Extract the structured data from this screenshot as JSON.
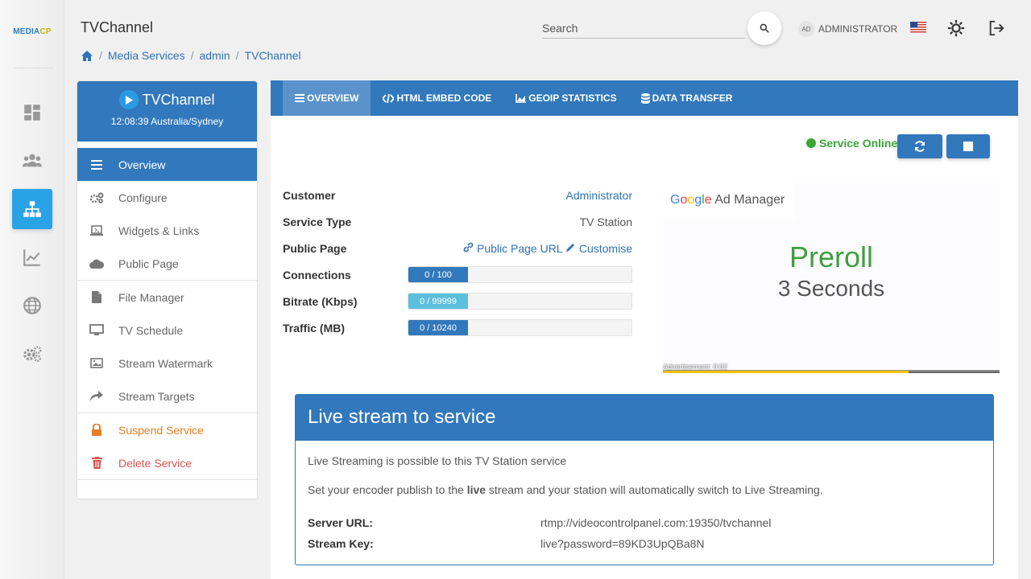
{
  "brand": {
    "m": "M",
    "rest": "EDIA",
    "cp": "CP"
  },
  "rail": [
    {
      "icon": "dashboard-icon",
      "active": false
    },
    {
      "icon": "users-icon",
      "active": false
    },
    {
      "icon": "sitemap-icon",
      "active": true
    },
    {
      "icon": "chart-icon",
      "active": false
    },
    {
      "icon": "globe-icon",
      "active": false
    },
    {
      "icon": "cogs-icon",
      "active": false
    }
  ],
  "header": {
    "title": "TVChannel",
    "search_placeholder": "Search",
    "user_initials": "AD",
    "user_name": "ADMINISTRATOR"
  },
  "breadcrumb": [
    "Media Services",
    "admin",
    "TVChannel"
  ],
  "service": {
    "name": "TVChannel",
    "time": "12:08:39 Australia/Sydney",
    "menu": [
      {
        "label": "Overview",
        "icon": "list-icon"
      },
      {
        "label": "Configure",
        "icon": "cogs-icon"
      },
      {
        "label": "Widgets & Links",
        "icon": "widgets-icon"
      },
      {
        "label": "Public Page",
        "icon": "cloud-icon"
      },
      {
        "label": "File Manager",
        "icon": "file-icon"
      },
      {
        "label": "TV Schedule",
        "icon": "monitor-icon"
      },
      {
        "label": "Stream Watermark",
        "icon": "image-icon"
      },
      {
        "label": "Stream Targets",
        "icon": "share-icon"
      },
      {
        "label": "Suspend Service",
        "icon": "lock-icon"
      },
      {
        "label": "Delete Service",
        "icon": "trash-icon"
      }
    ]
  },
  "tabs": [
    {
      "label": "OVERVIEW",
      "icon": "list-icon"
    },
    {
      "label": "HTML EMBED CODE",
      "icon": "code-icon"
    },
    {
      "label": "GEOIP STATISTICS",
      "icon": "area-chart-icon"
    },
    {
      "label": "DATA TRANSFER",
      "icon": "database-icon"
    }
  ],
  "status": "Service Online",
  "overview": {
    "customer_label": "Customer",
    "customer_value": "Administrator",
    "type_label": "Service Type",
    "type_value": "TV Station",
    "public_label": "Public Page",
    "public_url": "Public Page URL",
    "customise": "Customise",
    "connections_label": "Connections",
    "connections_value": "0 / 100",
    "bitrate_label": "Bitrate (Kbps)",
    "bitrate_value": "0 / 99999",
    "traffic_label": "Traffic (MB)",
    "traffic_value": "0 / 10240"
  },
  "ad": {
    "provider": "Ad Manager",
    "title": "Preroll",
    "subtitle": "3 Seconds",
    "countdown": "Advertisement: 0:02",
    "progress": 0.73
  },
  "live": {
    "title": "Live stream to service",
    "line1": "Live Streaming is possible to this TV Station service",
    "line2_pre": "Set your encoder publish to the ",
    "line2_bold": "live",
    "line2_post": " stream and your station will automatically switch to Live Streaming.",
    "server_label": "Server URL:",
    "server_value": "rtmp://videocontrolpanel.com:19350/tvchannel",
    "key_label": "Stream Key:",
    "key_value": "live?password=89KD3UpQBa8N"
  },
  "colors": {
    "primary": "#3278bc",
    "online": "#3aa635",
    "info_bar": "#5bc0de",
    "warn": "#e67e22",
    "danger": "#d9534f"
  }
}
